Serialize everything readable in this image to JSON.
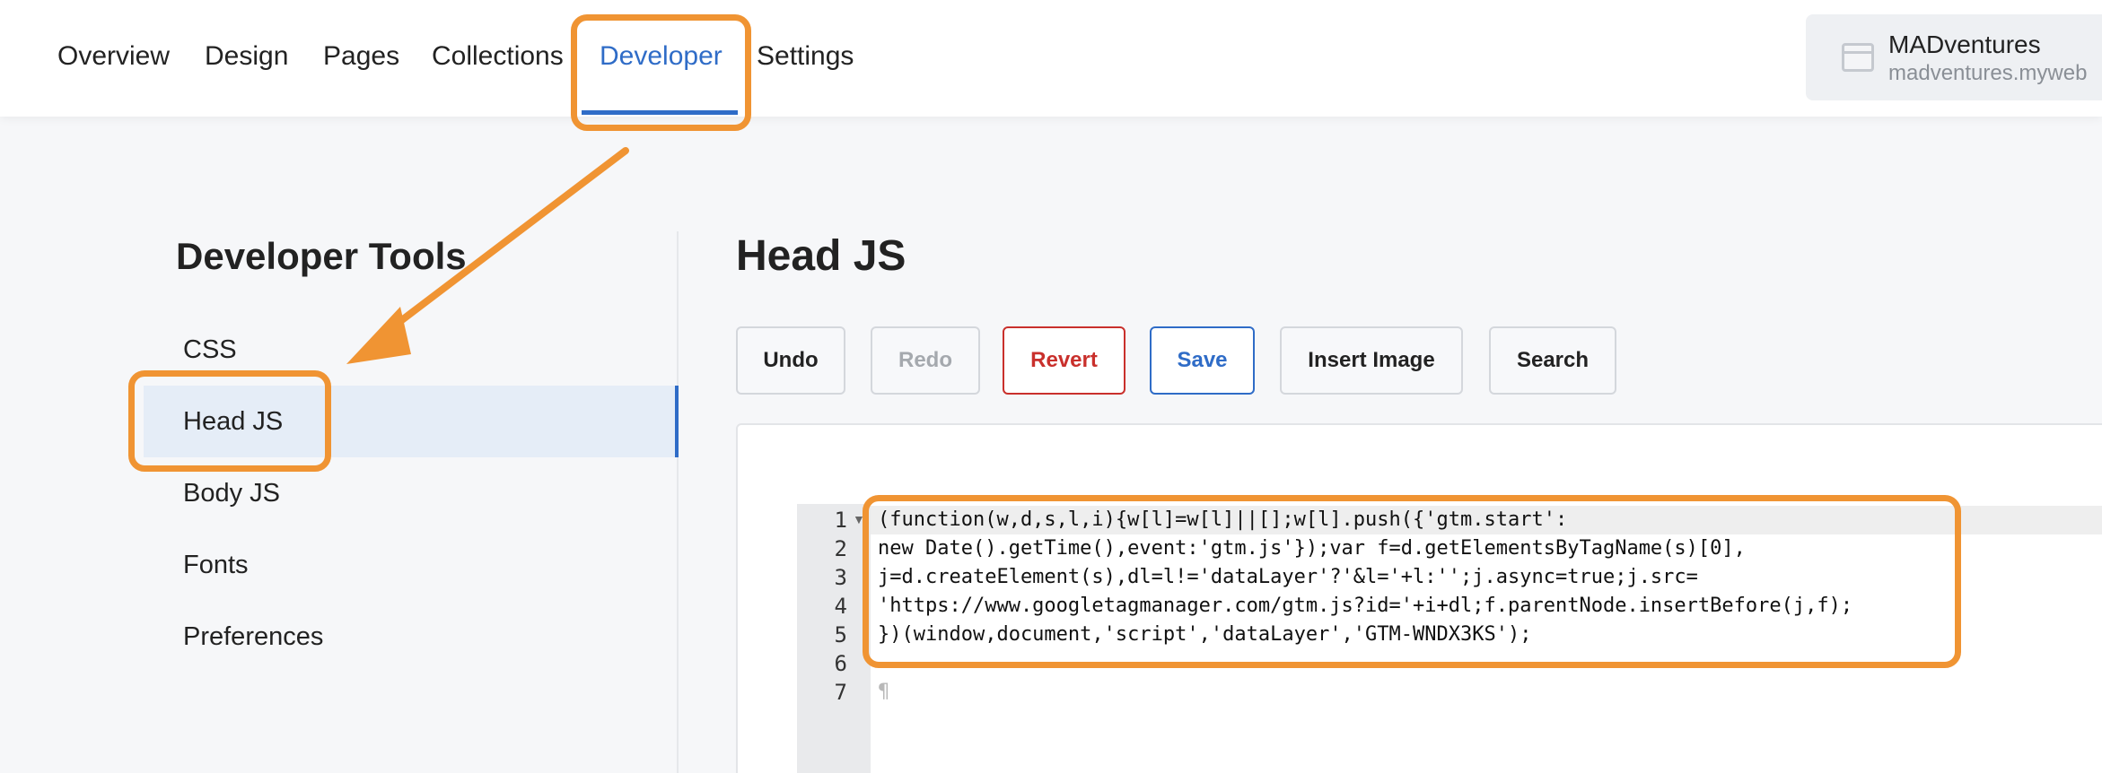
{
  "nav": {
    "tabs": [
      {
        "label": "Overview"
      },
      {
        "label": "Design"
      },
      {
        "label": "Pages"
      },
      {
        "label": "Collections"
      },
      {
        "label": "Developer"
      },
      {
        "label": "Settings"
      }
    ],
    "active_tab": "Developer"
  },
  "site": {
    "name": "MADventures",
    "url": "madventures.myweb"
  },
  "sidebar": {
    "title": "Developer Tools",
    "items": [
      {
        "label": "CSS"
      },
      {
        "label": "Head JS"
      },
      {
        "label": "Body JS"
      },
      {
        "label": "Fonts"
      },
      {
        "label": "Preferences"
      }
    ],
    "active_item": "Head JS"
  },
  "main": {
    "title": "Head JS",
    "toolbar": {
      "undo": "Undo",
      "redo": "Redo",
      "revert": "Revert",
      "save": "Save",
      "insert_image": "Insert Image",
      "search": "Search"
    },
    "editor": {
      "line_numbers": [
        "1",
        "2",
        "3",
        "4",
        "5",
        "6",
        "7"
      ],
      "lines": [
        "(function(w,d,s,l,i){w[l]=w[l]||[];w[l].push({'gtm.start':",
        "new Date().getTime(),event:'gtm.js'});var f=d.getElementsByTagName(s)[0],",
        "j=d.createElement(s),dl=l!='dataLayer'?'&l='+l:'';j.async=true;j.src=",
        "'https://www.googletagmanager.com/gtm.js?id='+i+dl;f.parentNode.insertBefore(j,f);",
        "})(window,document,'script','dataLayer','GTM-WNDX3KS');",
        "",
        "¶"
      ]
    }
  },
  "colors": {
    "accent": "#2f6cc7",
    "annotation": "#f09433",
    "revert": "#c9302c"
  }
}
